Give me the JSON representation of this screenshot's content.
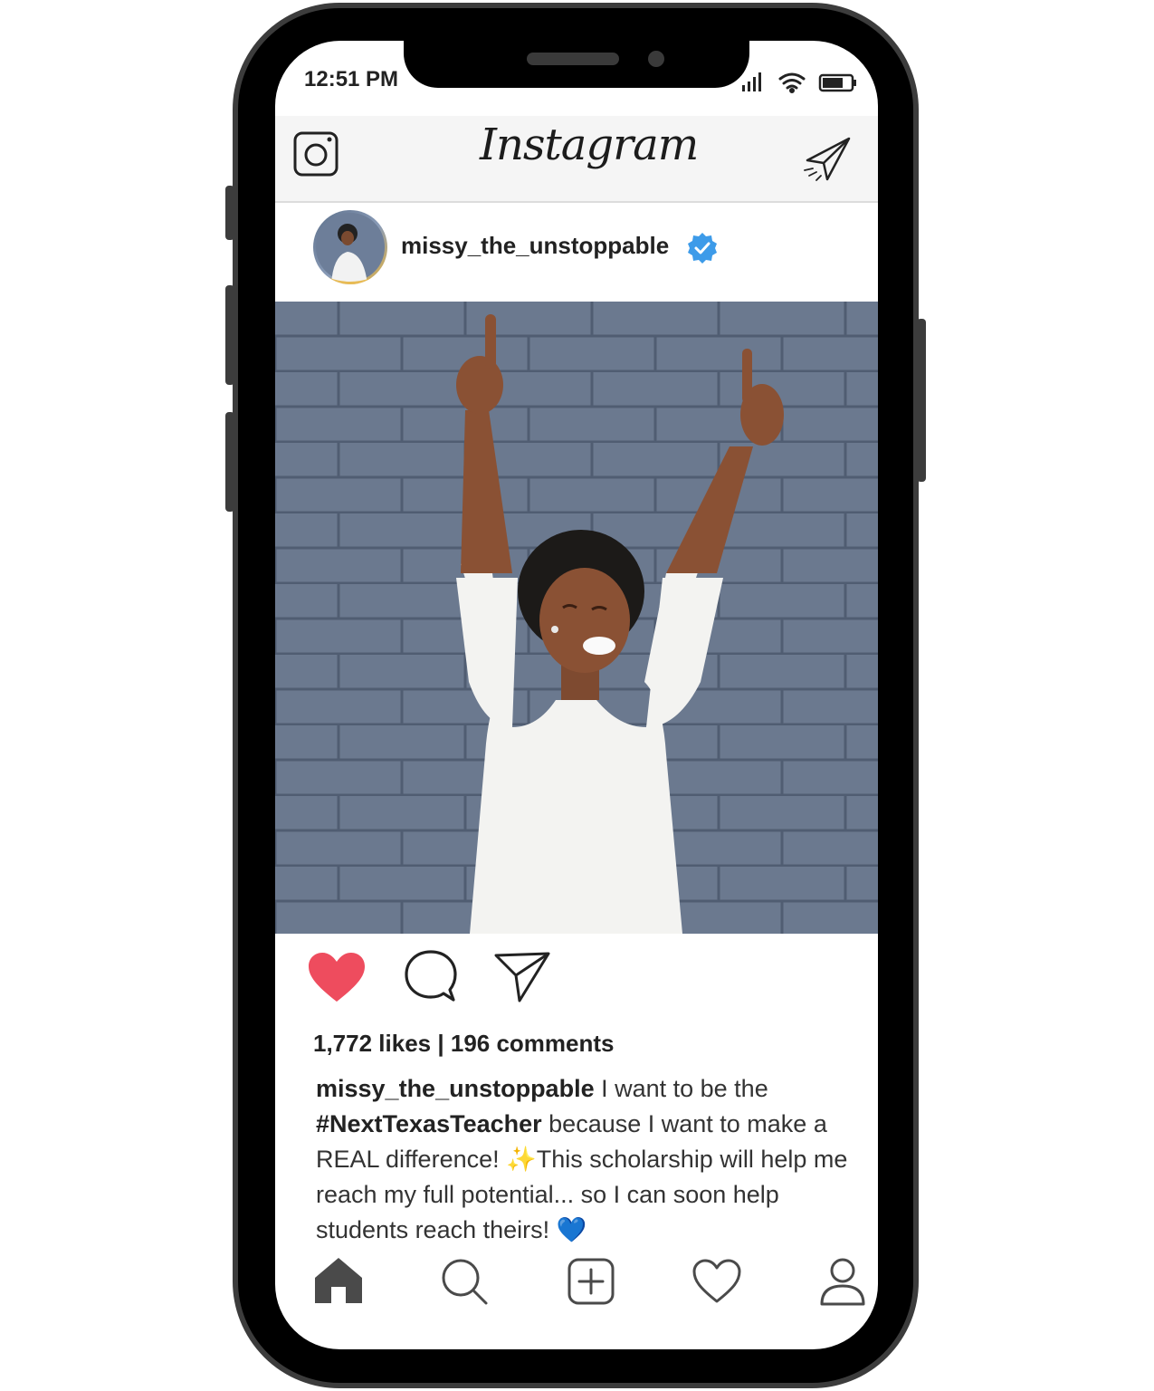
{
  "status": {
    "time": "12:51 PM"
  },
  "header": {
    "logo": "Instagram"
  },
  "post": {
    "username": "missy_the_unstoppable",
    "verified": true,
    "likes": "1,772 likes",
    "separator": " | ",
    "comments": "196 comments",
    "caption": {
      "username": "missy_the_unstoppable",
      "part1": " I want to be the ",
      "hashtag": "#NextTexasTeacher",
      "part2": " because I want to make a REAL difference! ",
      "sparkle": "✨",
      "part3": "This scholarship will help me reach my full potential... so I can soon help students reach theirs! ",
      "heart": "💙"
    },
    "liked": true
  },
  "bottom_nav": [
    "home-icon",
    "search-icon",
    "add-post-icon",
    "activity-heart-icon",
    "profile-icon"
  ],
  "colors": {
    "like_red": "#ee4c5e",
    "verified_blue": "#3d9be9",
    "wall_gray": "#6c7a8f"
  }
}
